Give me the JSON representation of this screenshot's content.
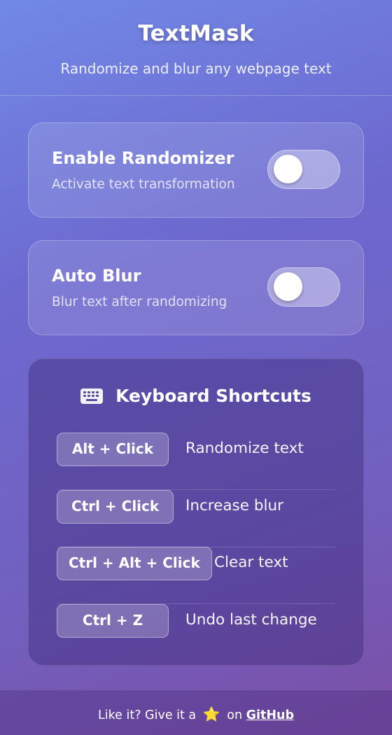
{
  "header": {
    "title": "TextMask",
    "subtitle": "Randomize and blur any webpage text"
  },
  "settings": [
    {
      "label": "Enable Randomizer",
      "description": "Activate text transformation",
      "enabled": false
    },
    {
      "label": "Auto Blur",
      "description": "Blur text after randomizing",
      "enabled": false
    }
  ],
  "shortcuts": {
    "heading": "Keyboard Shortcuts",
    "icon": "keyboard-icon",
    "items": [
      {
        "key": "Alt + Click",
        "action": "Randomize text"
      },
      {
        "key": "Ctrl + Click",
        "action": "Increase blur"
      },
      {
        "key": "Ctrl + Alt + Click",
        "action": "Clear text"
      },
      {
        "key": "Ctrl + Z",
        "action": "Undo last change"
      }
    ]
  },
  "footer": {
    "prefix": "Like it? Give it a",
    "star": "⭐",
    "middle": "on",
    "link_text": "GitHub"
  }
}
